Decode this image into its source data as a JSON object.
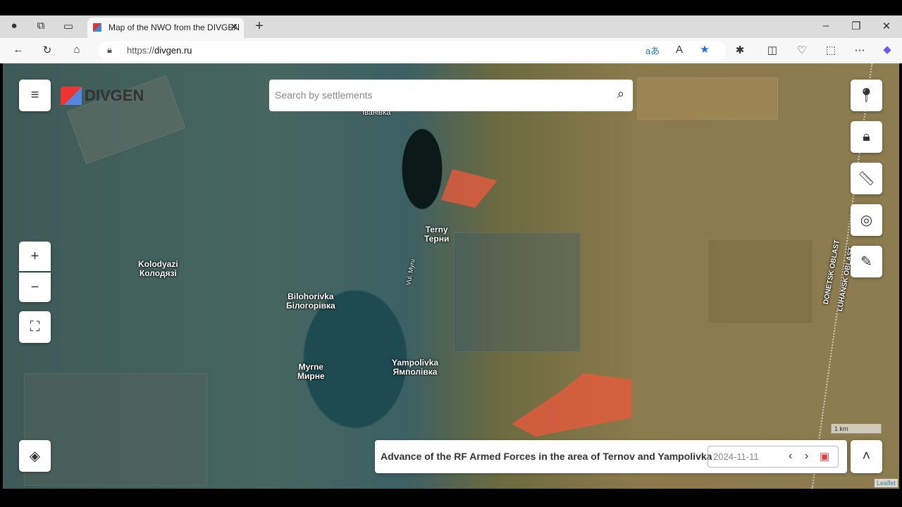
{
  "browser": {
    "tab_title": "Map of the NWO from the DIVGEN",
    "url_prefix": "https://",
    "url_domain": "divgen.ru"
  },
  "app": {
    "logo": "DIVGEN",
    "search_placeholder": "Search by settlements"
  },
  "map": {
    "labels": [
      {
        "en": "Іванівка",
        "uk": ""
      },
      {
        "en": "Terny",
        "uk": "Терни"
      },
      {
        "en": "Kolodyazi",
        "uk": "Колодязі"
      },
      {
        "en": "Bilohorivka",
        "uk": "Білогорівка"
      },
      {
        "en": "Myrne",
        "uk": "Мирне"
      },
      {
        "en": "Yampolivka",
        "uk": "Ямполівка"
      }
    ],
    "street": "Vul. Myru",
    "oblast_donetsk": "DONETSK OBLAST",
    "oblast_luhansk": "LUHANSK OBLAST",
    "scale": "1 km",
    "attribution": "Leaflet"
  },
  "panel": {
    "title": "Advance of the RF Armed Forces in the area of Ternov and Yampolivka",
    "date": "2024-11-11"
  },
  "colors": {
    "advance_area": "#e65a3c",
    "calendar": "#e04040"
  }
}
